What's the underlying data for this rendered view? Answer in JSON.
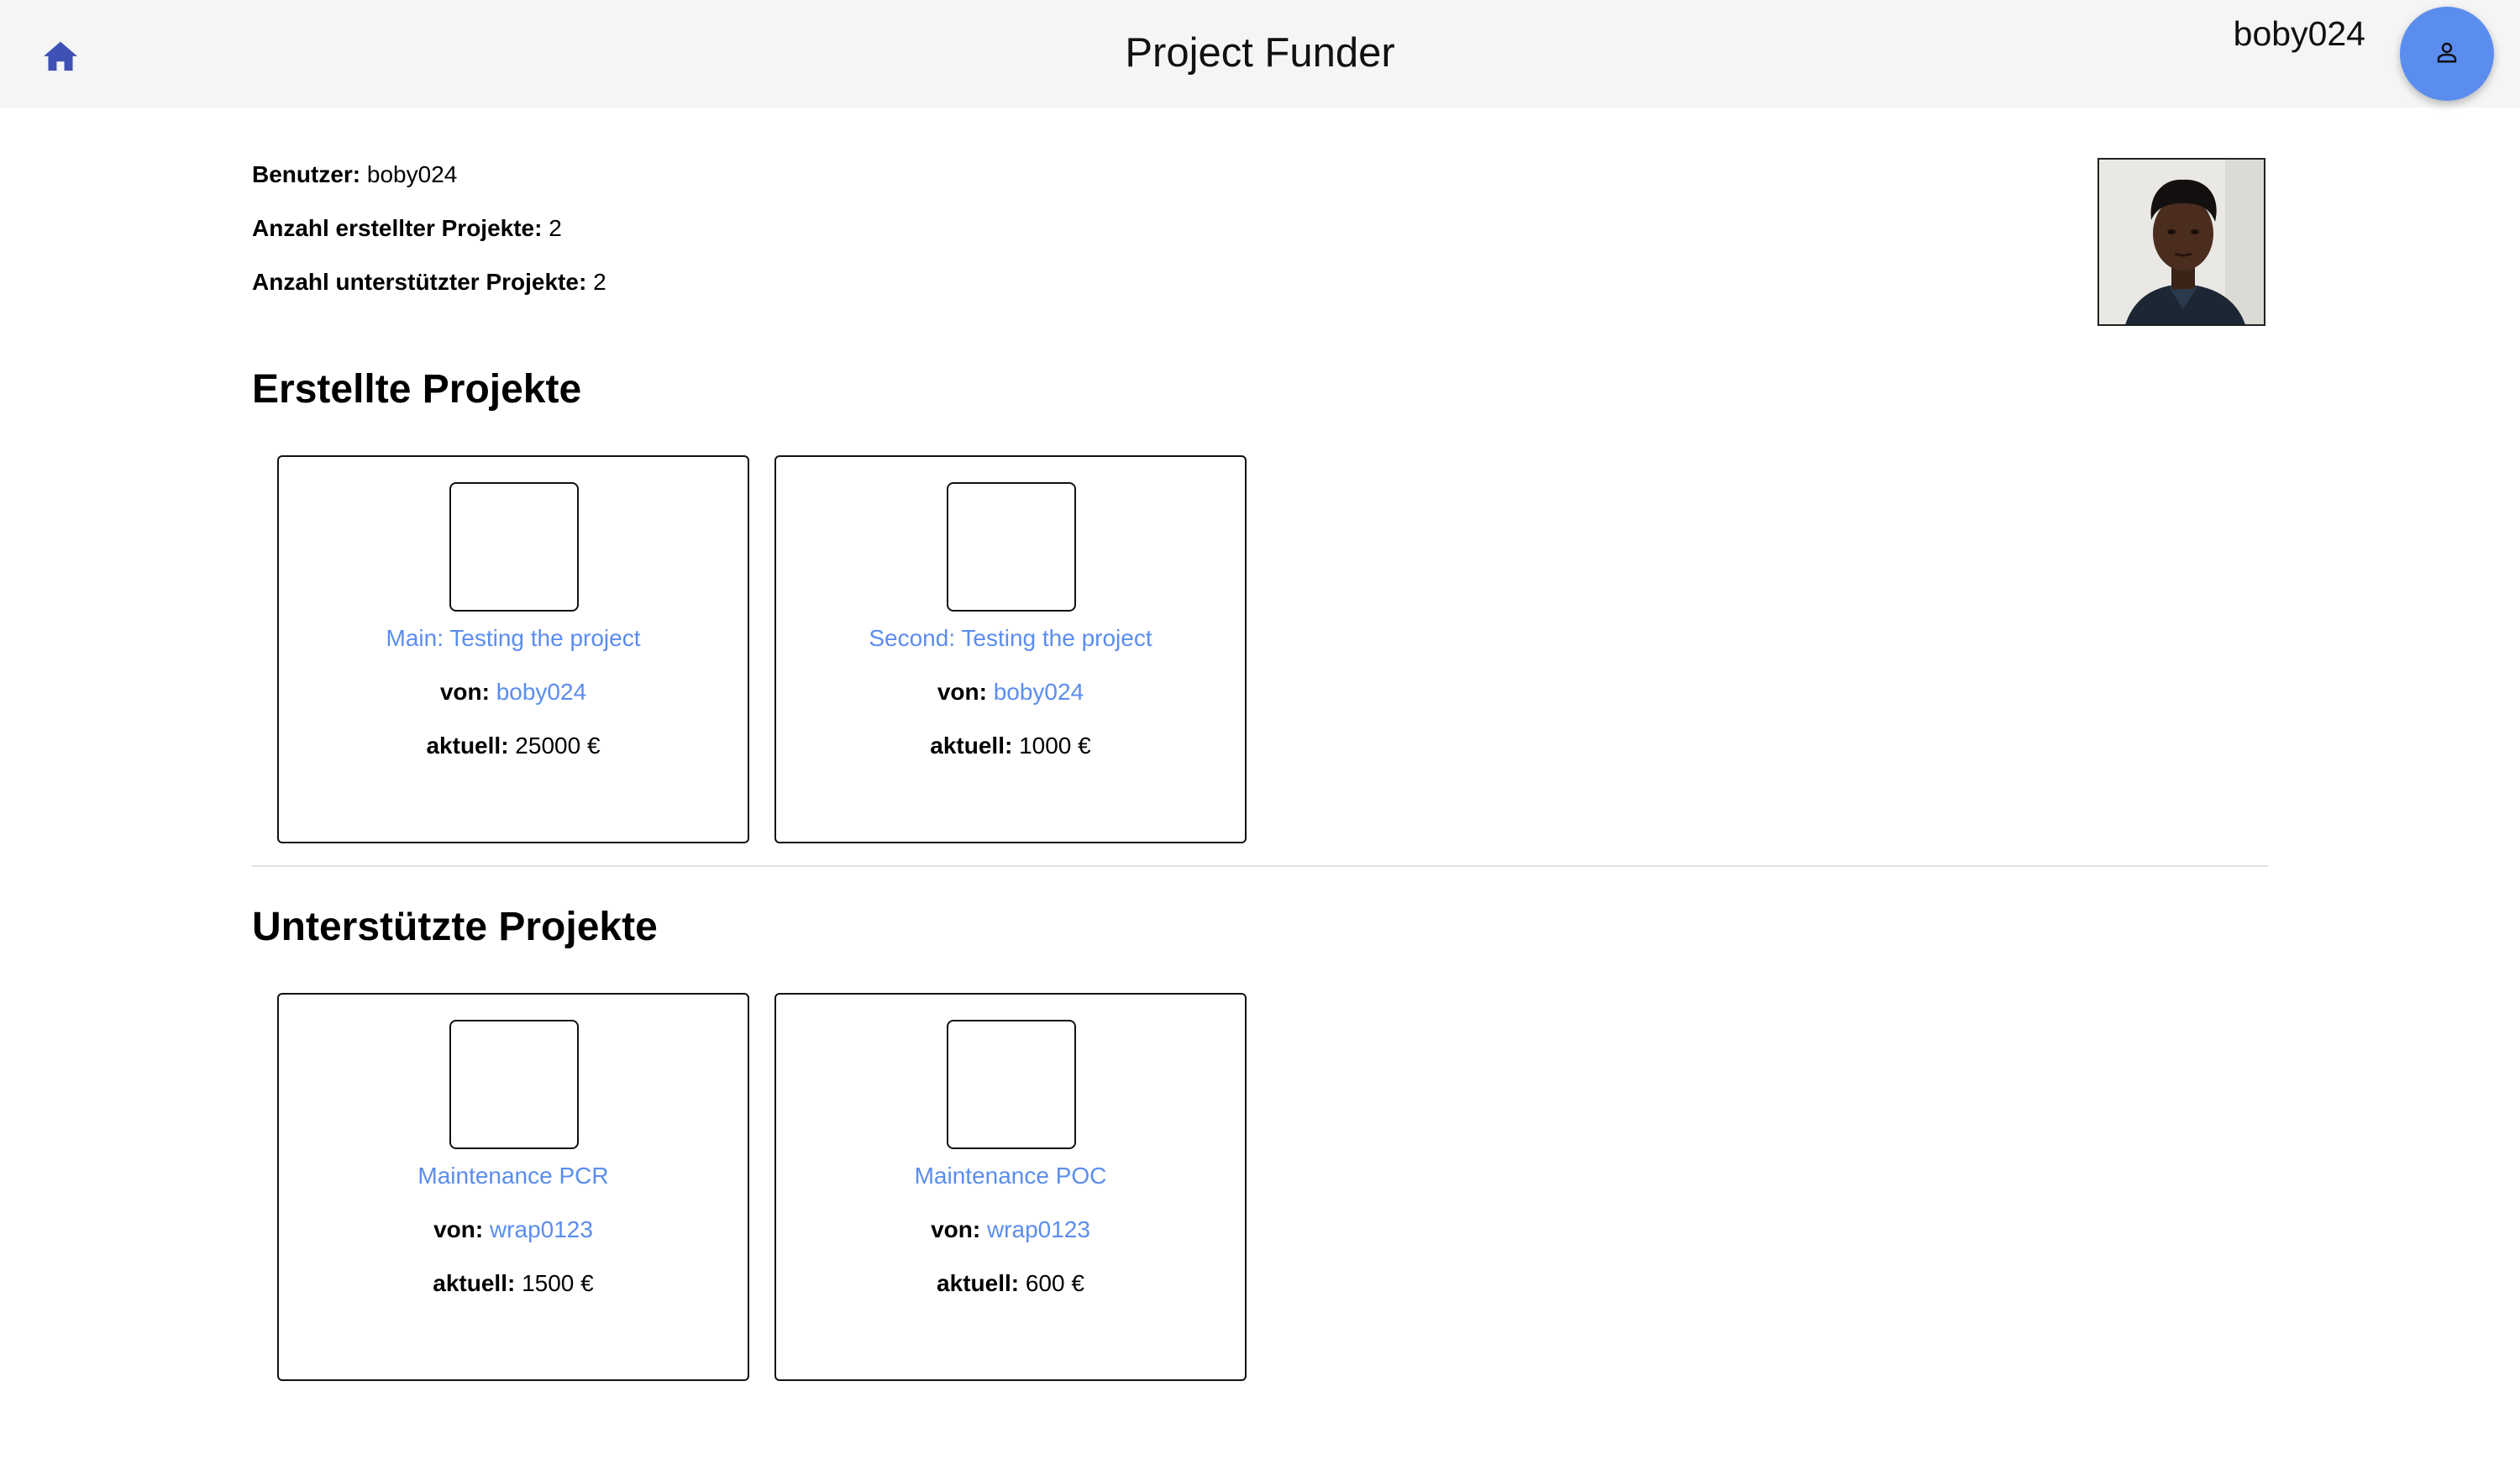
{
  "header": {
    "title": "Project Funder",
    "username": "boby024",
    "home_icon": "home-icon",
    "account_icon": "person-icon",
    "accent_color": "#5b8def",
    "home_icon_color": "#3f51b5"
  },
  "profile": {
    "user_label": "Benutzer:",
    "user_value": "boby024",
    "created_count_label": "Anzahl erstellter Projekte:",
    "created_count_value": "2",
    "supported_count_label": "Anzahl unterstützter Projekte:",
    "supported_count_value": "2"
  },
  "created_section": {
    "title": "Erstellte Projekte",
    "projects": [
      {
        "title": "Main: Testing the project",
        "by_label": "von:",
        "author": "boby024",
        "amount_label": "aktuell:",
        "amount": "25000 €"
      },
      {
        "title": "Second: Testing the project",
        "by_label": "von:",
        "author": "boby024",
        "amount_label": "aktuell:",
        "amount": "1000 €"
      }
    ]
  },
  "supported_section": {
    "title": "Unterstützte Projekte",
    "projects": [
      {
        "title": "Maintenance PCR",
        "by_label": "von:",
        "author": "wrap0123",
        "amount_label": "aktuell:",
        "amount": "1500 €"
      },
      {
        "title": "Maintenance POC",
        "by_label": "von:",
        "author": "wrap0123",
        "amount_label": "aktuell:",
        "amount": "600 €"
      }
    ]
  }
}
